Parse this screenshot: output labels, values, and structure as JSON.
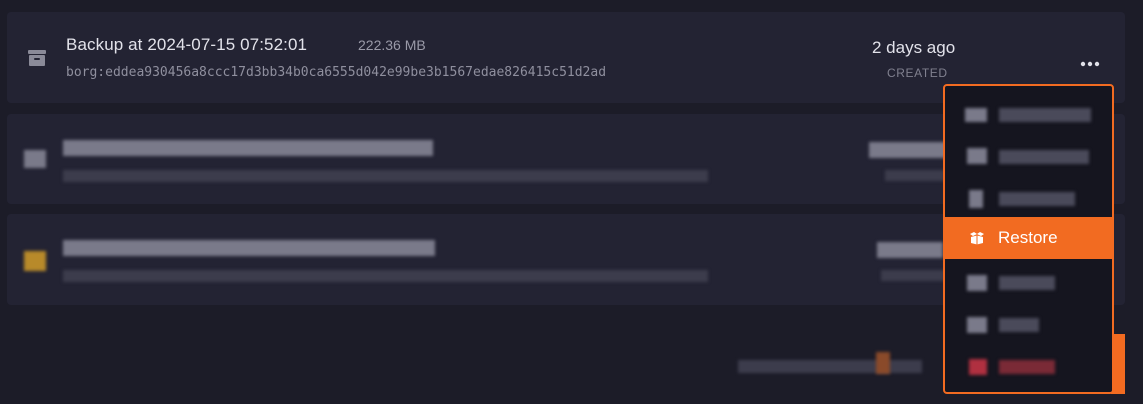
{
  "backups": [
    {
      "title": "Backup at 2024-07-15 07:52:01",
      "size": "222.36 MB",
      "hash": "borg:eddea930456a8ccc17d3bb34b0ca6555d042e99be3b1567edae826415c51d2ad",
      "time": "2 days ago",
      "time_label": "CREATED",
      "icon": "archive-icon"
    }
  ],
  "menu": {
    "restore_label": "Restore",
    "restore_icon": "box-open-icon"
  },
  "colors": {
    "accent": "#f26b21",
    "background": "#1c1c28",
    "row": "#232333"
  }
}
